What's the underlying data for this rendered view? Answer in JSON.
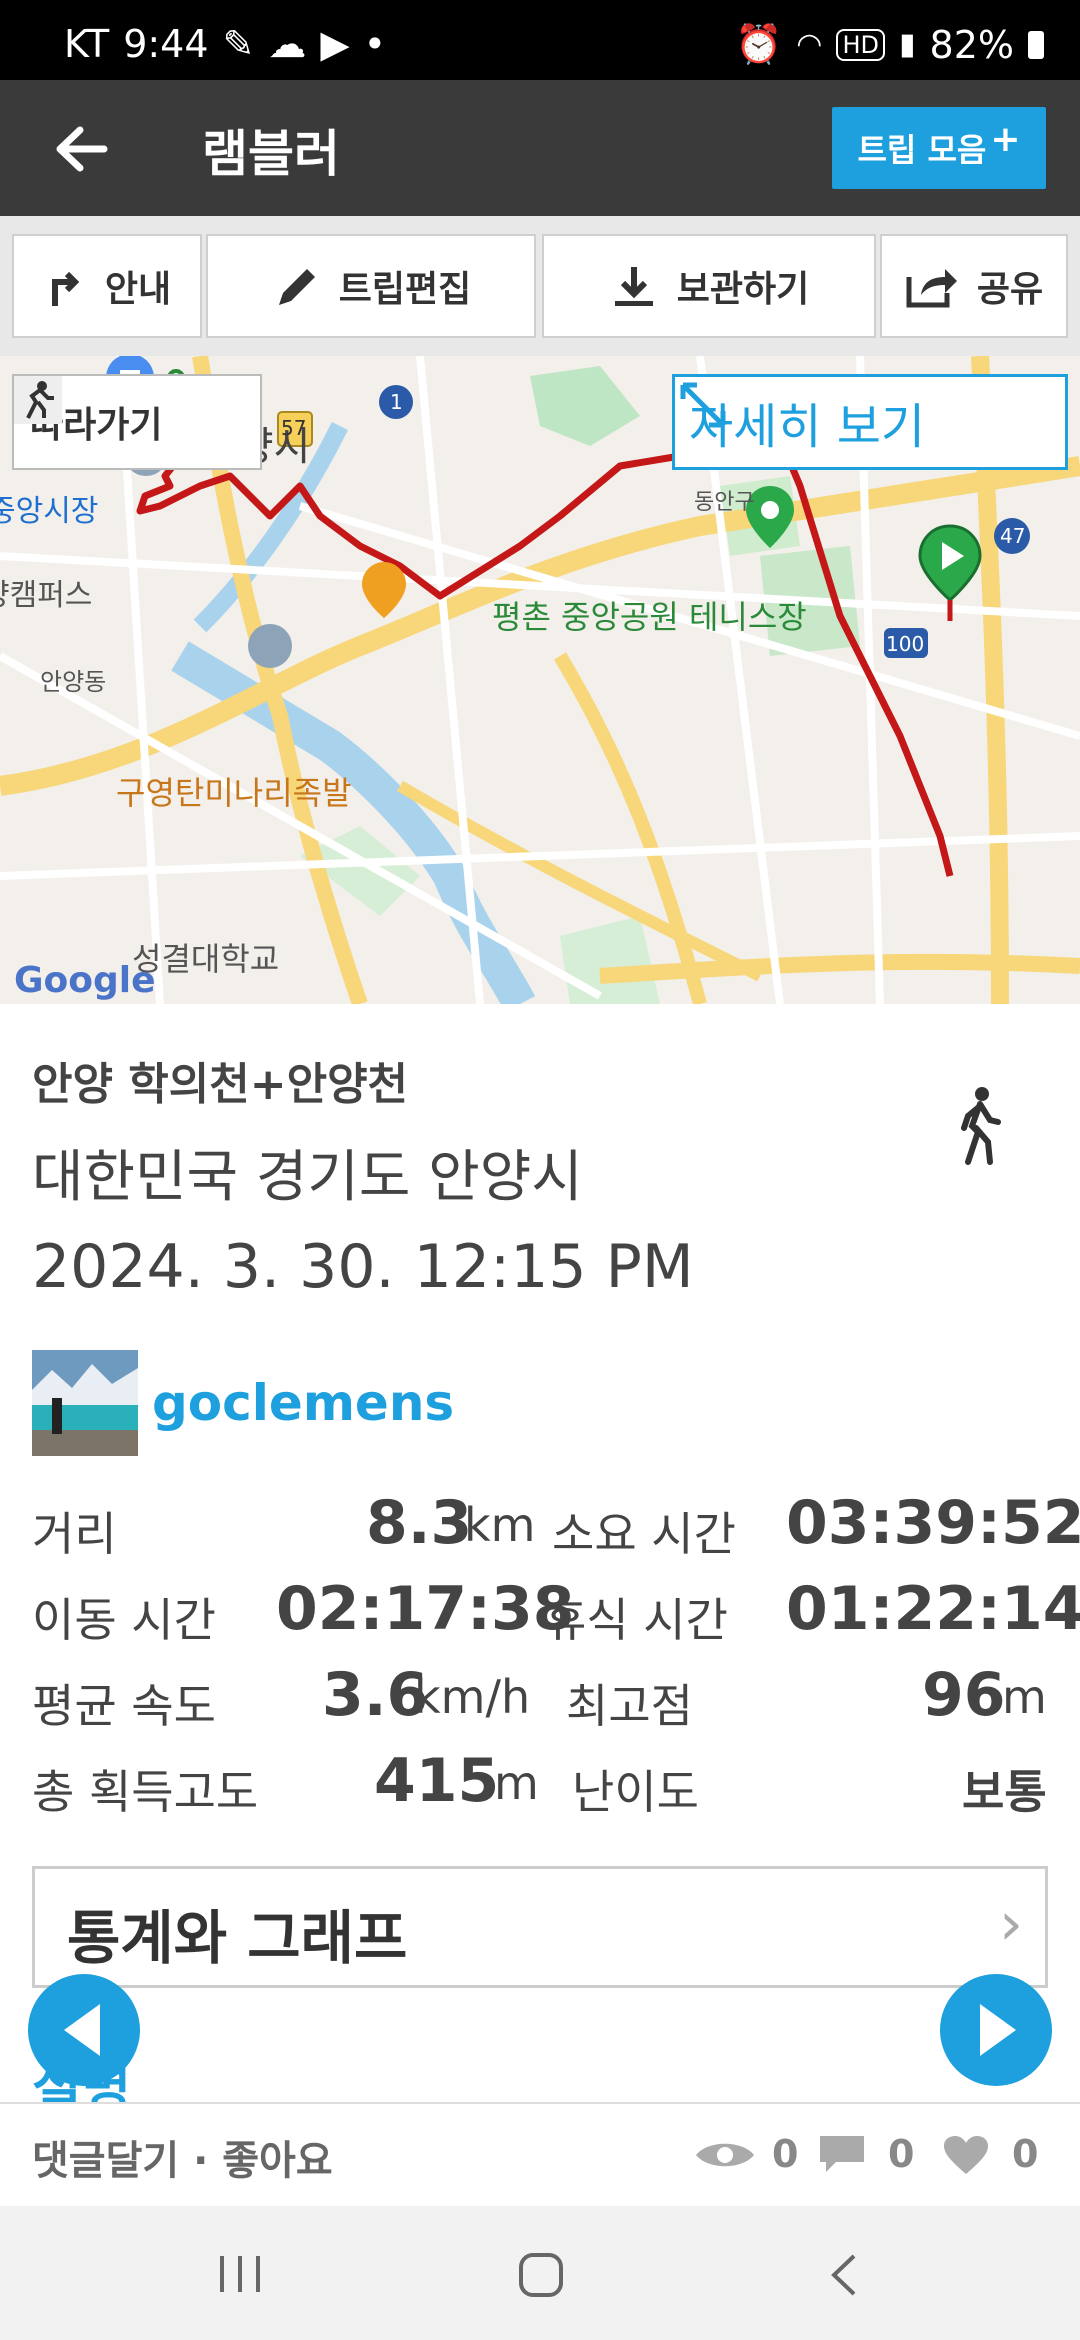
{
  "status": {
    "carrier": "KT",
    "time": "9:44",
    "battery": "82%"
  },
  "appbar": {
    "title": "램블러",
    "trip_button": "트립 모음"
  },
  "toolbar": {
    "guide": "안내",
    "edit": "트립편집",
    "save": "보관하기",
    "share": "공유"
  },
  "map": {
    "follow": "따라가기",
    "detail": "자세히 보기",
    "labels": {
      "city": "안양시",
      "market": "중앙시장",
      "campus": "양캠퍼스",
      "dong": "안양동",
      "district": "동안구",
      "park": "평촌 중앙공원 테니스장",
      "restaurant": "구영탄미나리족발",
      "college": "성결대학교",
      "route57": "57",
      "route1": "1",
      "route47": "47",
      "route100": "100",
      "google": "Google"
    }
  },
  "trip": {
    "name": "안양 학의천+안양천",
    "location": "대한민국 경기도 안양시",
    "date": "2024. 3. 30. 12:15 PM",
    "user": "goclemens"
  },
  "stats": {
    "distance_label": "거리",
    "distance": "8.3",
    "distance_unit": "km",
    "duration_label": "소요 시간",
    "duration": "03:39:52",
    "moving_label": "이동 시간",
    "moving": "02:17:38",
    "rest_label": "휴식 시간",
    "rest": "01:22:14",
    "avg_speed_label": "평균 속도",
    "avg_speed": "3.6",
    "avg_speed_unit": "km/h",
    "max_alt_label": "최고점",
    "max_alt": "96",
    "max_alt_unit": "m",
    "gain_label": "총 획득고도",
    "gain": "415",
    "gain_unit": "m",
    "difficulty_label": "난이도",
    "difficulty": "보통"
  },
  "stats_graph": "통계와 그래프",
  "description": "설명",
  "bottombar": {
    "actions": "댓글달기 · 좋아요",
    "views": "0",
    "comments": "0",
    "likes": "0"
  }
}
